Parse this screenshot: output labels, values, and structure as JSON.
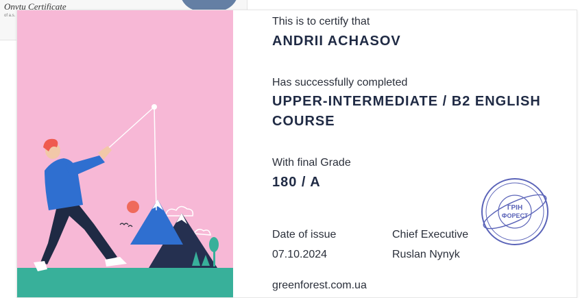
{
  "background_doc": {
    "logo_text": "Onvtu Certificate",
    "line_text": "of a.s. Tr"
  },
  "certificate": {
    "intro": "This is to certify that",
    "name": "ANDRII ACHASOV",
    "completed_label": "Has successfully completed",
    "course_line1": "UPPER-INTERMEDIATE / B2 ENGLISH",
    "course_line2": "COURSE",
    "grade_label": "With final Grade",
    "grade": "180 / A",
    "date_label": "Date of issue",
    "date": "07.10.2024",
    "exec_label": "Chief Executive",
    "exec_name": "Ruslan Nynyk",
    "website": "greenforest.com.ua"
  },
  "stamp": {
    "center_line1": "ГРІН",
    "center_line2": "ФОРЕСТ"
  },
  "colors": {
    "pink": "#f7b8d6",
    "teal": "#38b09a",
    "navy": "#1f2a44",
    "stamp_blue": "#5a63b8"
  }
}
